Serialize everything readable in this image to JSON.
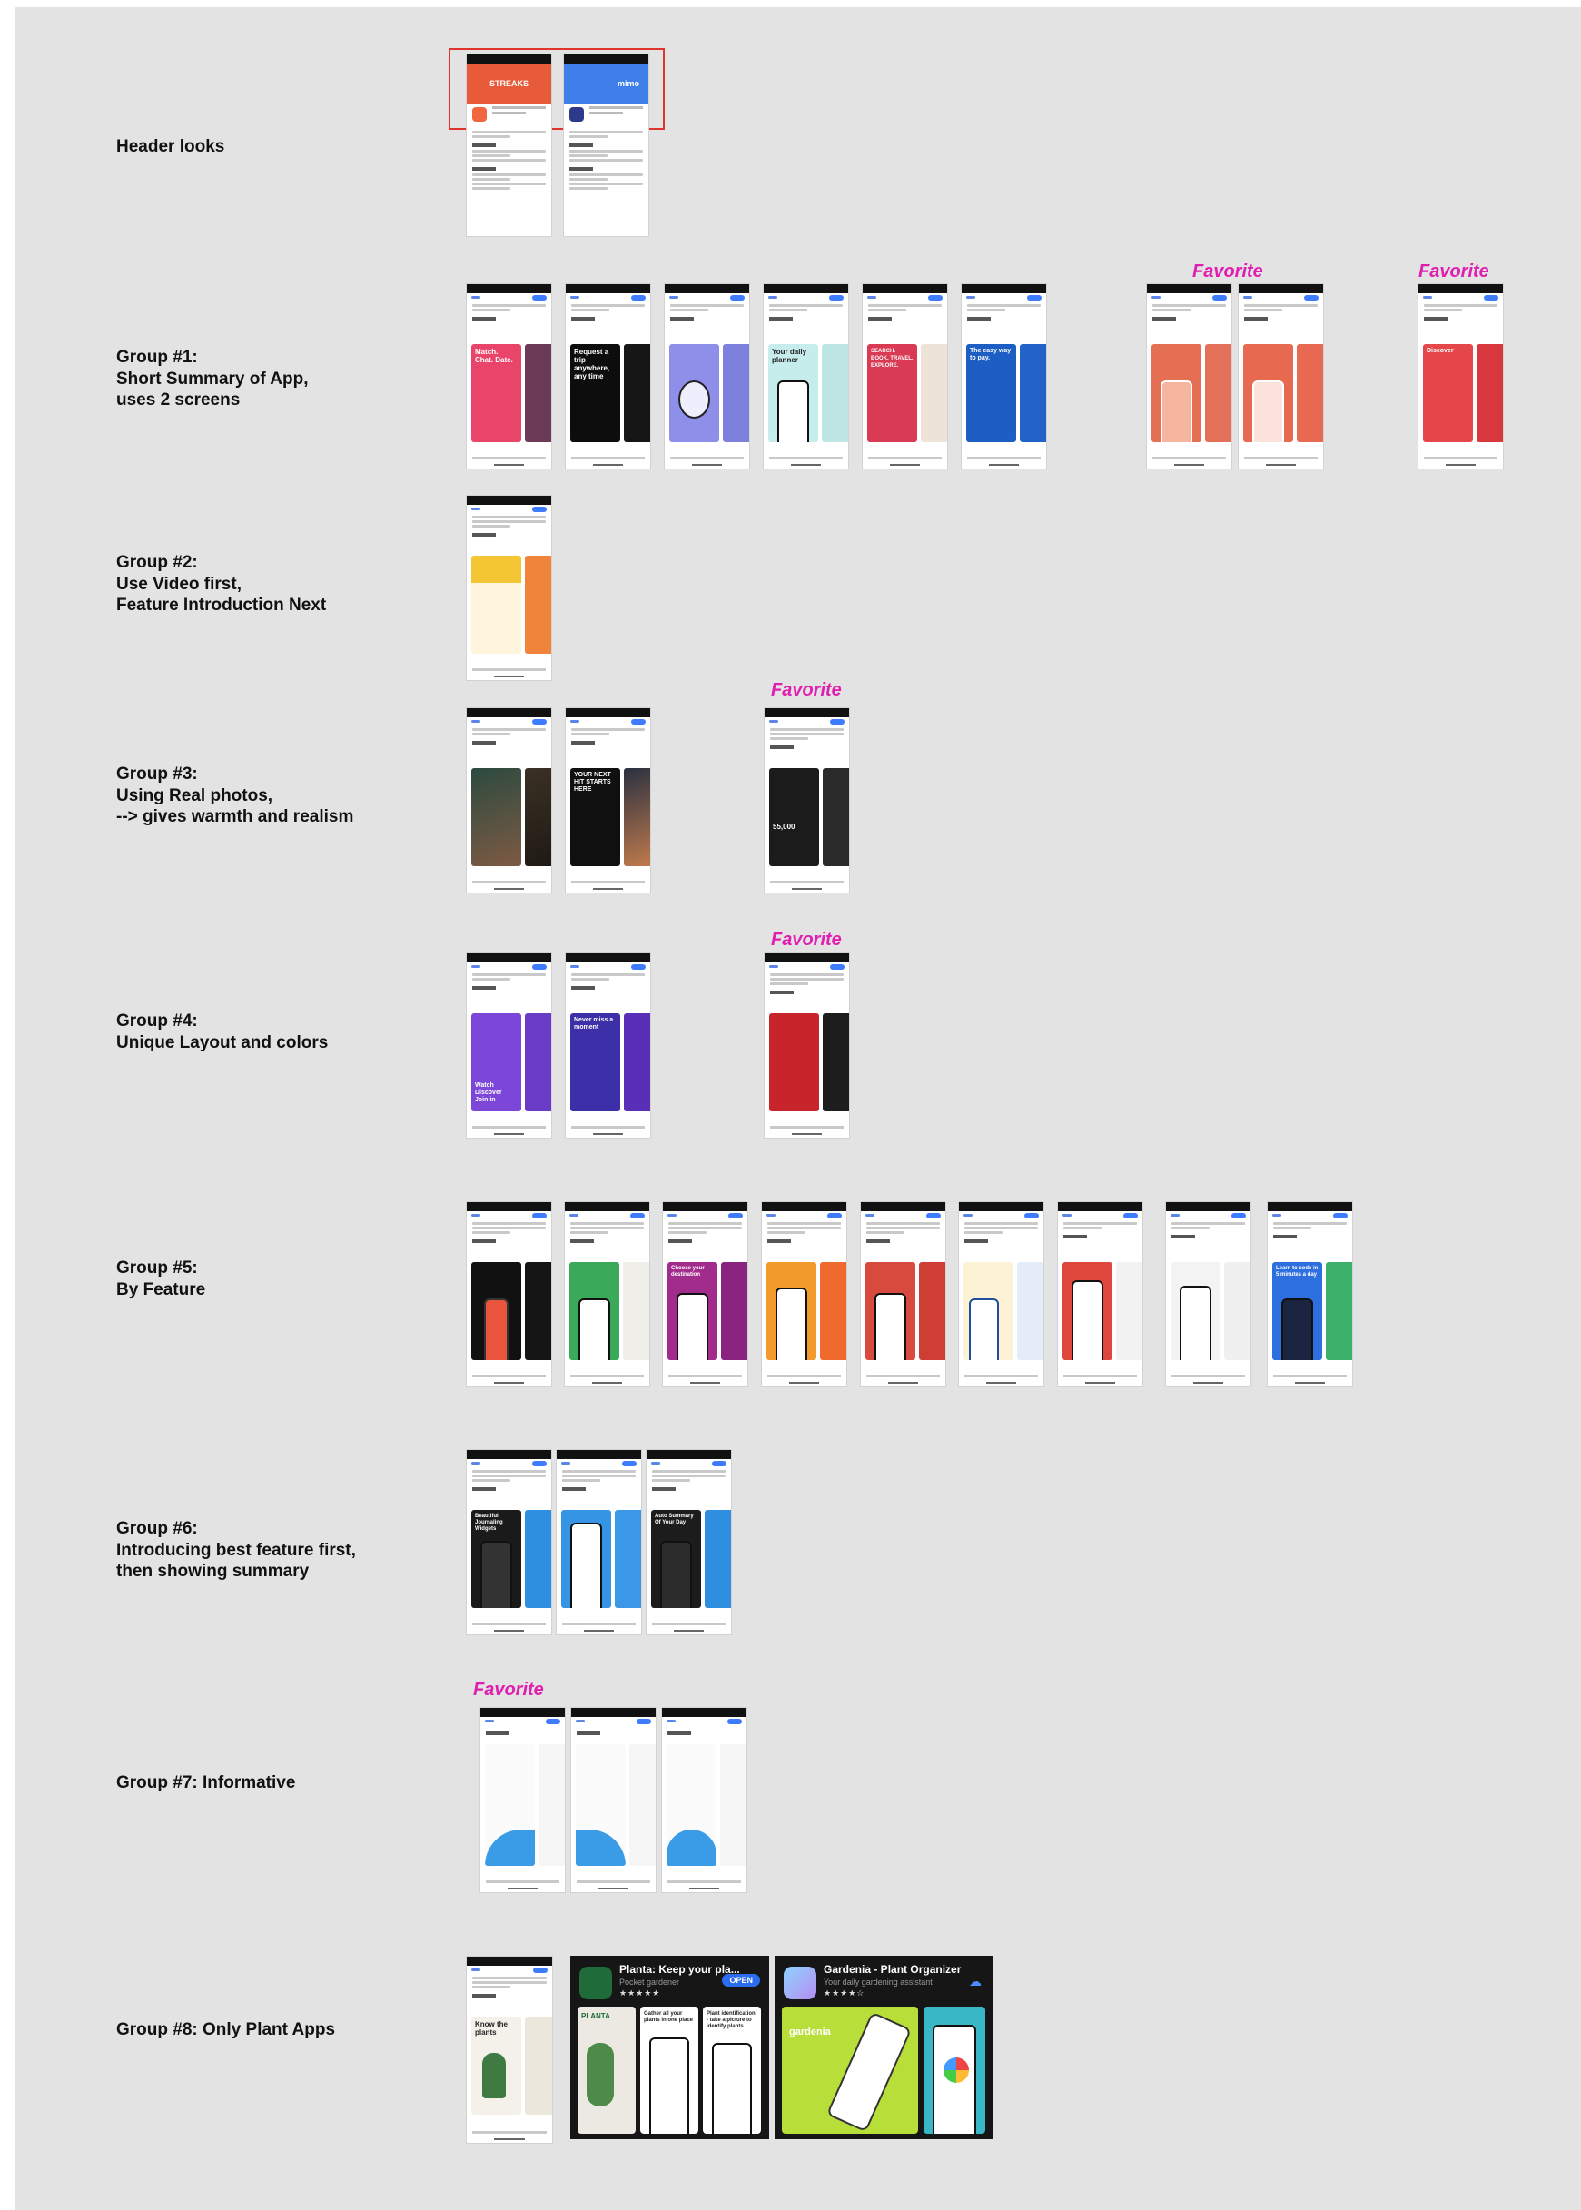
{
  "labels": {
    "header": [
      "Header looks"
    ],
    "g1": [
      "Group #1:",
      "Short Summary of App,",
      "uses 2 screens"
    ],
    "g2": [
      "Group #2:",
      "Use Video first,",
      "Feature Introduction Next"
    ],
    "g3": [
      "Group #3:",
      "Using Real photos,",
      "--> gives warmth and realism"
    ],
    "g4": [
      "Group #4:",
      "Unique Layout and colors"
    ],
    "g5": [
      "Group #5:",
      "By Feature"
    ],
    "g6": [
      "Group #6:",
      "Introducing best feature first,",
      "then showing summary"
    ],
    "g7": [
      "Group #7: Informative"
    ],
    "g8": [
      "Group #8: Only Plant Apps"
    ]
  },
  "favorite_label": "Favorite",
  "header_shots": {
    "streaks_banner": "STREAKS",
    "mimo_banner": "mimo"
  },
  "shot_texts": {
    "match_chat_date": "Match. Chat. Date.",
    "request_trip": "Request a trip anywhere, any time",
    "your_daily_planner": "Your daily planner",
    "search_book": "SEARCH. BOOK. TRAVEL. EXPLORE.",
    "easy_way_to_pay": "The easy way to pay.",
    "your_next_hit": "YOUR NEXT HIT STARTS HERE",
    "stat_55000": "55,000",
    "watch_discover": "Watch Discover Join in",
    "never_miss": "Never miss a moment",
    "choose_destination": "Choose your destination",
    "beautiful_journaling": "Beautiful Journaling Widgets",
    "auto_summary": "Auto Summary Of Your Day",
    "know_the_plants": "Know the plants",
    "discover": "Discover",
    "learn_to_code": "Learn to code in 5 minutes a day"
  },
  "planta": {
    "name": "Planta: Keep your pla...",
    "subtitle": "Pocket gardener",
    "stars": "★★★★★",
    "button": "OPEN",
    "logo_text": "PLANTA",
    "panel2": "Gather all your plants in one place",
    "panel3": "Plant identification - take a picture to identify plants"
  },
  "gardenia": {
    "name": "Gardenia - Plant Organizer",
    "subtitle": "Your daily gardening assistant",
    "stars": "★★★★☆",
    "logo_text": "gardenia"
  },
  "colors": {
    "board": "#e3e3e3",
    "favorite": "#e01fb0",
    "highlight": "#e0342c"
  },
  "icons": [
    "cloud-download-icon",
    "back-arrow-icon"
  ]
}
